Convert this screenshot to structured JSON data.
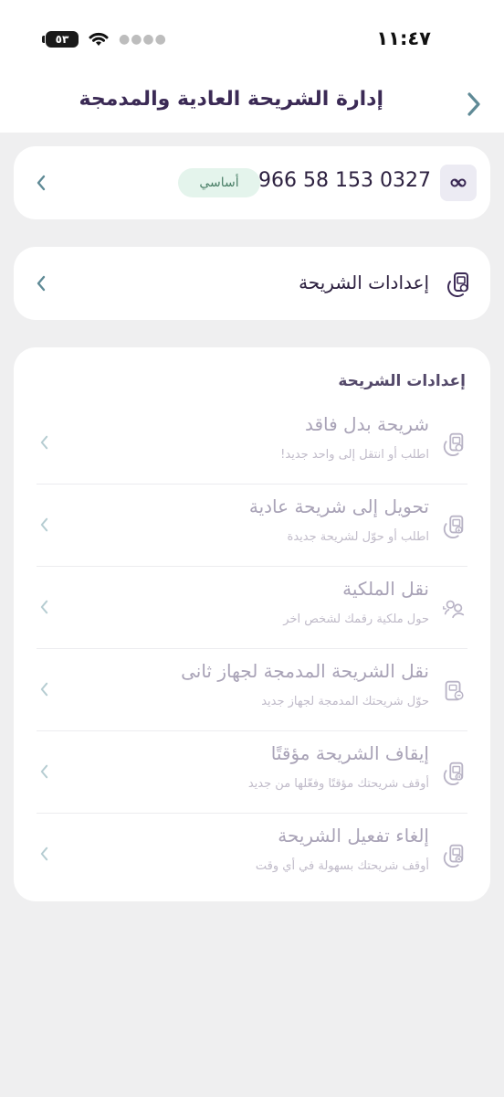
{
  "status_bar": {
    "time": "١١:٤٧",
    "battery": "٥٣"
  },
  "header": {
    "title": "إدارة الشريحة العادية والمدمجة"
  },
  "line_card": {
    "phone_number": "+966 58 153 0327",
    "badge": "أساسي"
  },
  "sim_settings_card": {
    "label": "إعدادات الشريحة"
  },
  "settings_section": {
    "title": "إعدادات الشريحة",
    "items": [
      {
        "title": "شريحة بدل فاقد",
        "subtitle": "اطلب أو انتقل إلى واحد جديد!",
        "icon": "sim-card-icon"
      },
      {
        "title": "تحويل إلى شريحة عادية",
        "subtitle": "اطلب أو حوّل لشريحة جديدة",
        "icon": "sim-convert-icon"
      },
      {
        "title": "نقل الملكية",
        "subtitle": "حول ملكية رقمك لشخص اخر",
        "icon": "transfer-ownership-icon"
      },
      {
        "title": "نقل الشريحة المدمجة لجهاز ثانى",
        "subtitle": "حوّل شريحتك المدمجة لجهاز جديد",
        "icon": "esim-device-icon"
      },
      {
        "title": "إيقاف الشريحة مؤقتًا",
        "subtitle": "أوقف شريحتك مؤقتًا وفعّلها من جديد",
        "icon": "sim-pause-icon"
      },
      {
        "title": "إلغاء تفعيل الشريحة",
        "subtitle": "أوقف شريحتك بسهولة في أي وقت",
        "icon": "sim-cancel-icon"
      }
    ]
  },
  "colors": {
    "background": "#efeff0",
    "primary_text": "#3b2a55",
    "chevron": "#5f8a96",
    "badge_bg": "#e4f4ec",
    "badge_text": "#4a7f67",
    "disabled_text": "#a9a3b7"
  }
}
